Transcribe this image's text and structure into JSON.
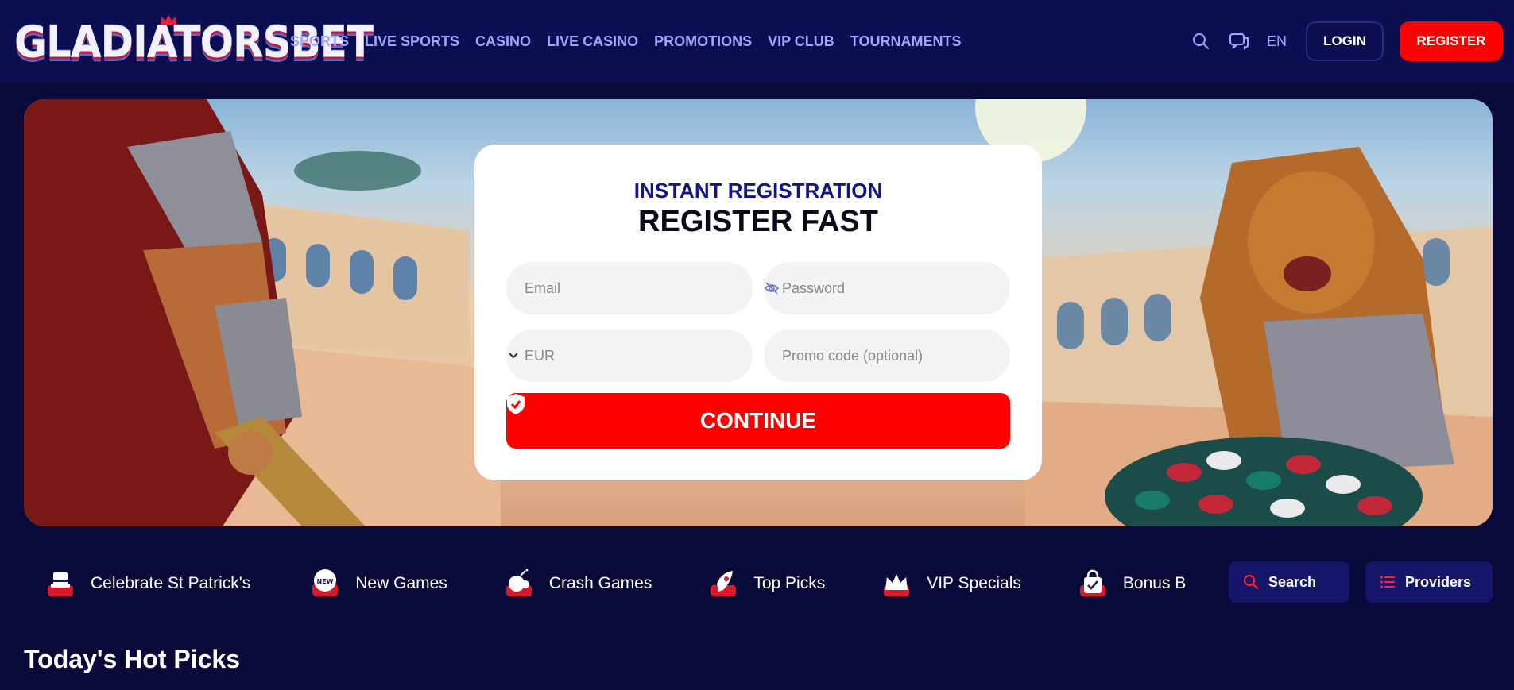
{
  "brand": {
    "logo_text": "GLADIATORSBET"
  },
  "nav": {
    "items": [
      "SPORTS",
      "LIVE SPORTS",
      "CASINO",
      "LIVE CASINO",
      "PROMOTIONS",
      "VIP CLUB",
      "TOURNAMENTS"
    ]
  },
  "header": {
    "language": "EN",
    "login_label": "LOGIN",
    "register_label": "REGISTER"
  },
  "registration": {
    "subtitle": "INSTANT REGISTRATION",
    "title": "REGISTER FAST",
    "email_placeholder": "Email",
    "password_placeholder": "Password",
    "currency_value": "EUR",
    "promo_placeholder": "Promo code (optional)",
    "continue_label": "CONTINUE"
  },
  "categories": {
    "items": [
      {
        "label": "Celebrate St Patrick's",
        "icon": "hat-icon"
      },
      {
        "label": "New Games",
        "icon": "new-badge-icon"
      },
      {
        "label": "Crash Games",
        "icon": "bomb-icon"
      },
      {
        "label": "Top Picks",
        "icon": "rocket-icon"
      },
      {
        "label": "VIP Specials",
        "icon": "crown-icon"
      },
      {
        "label": "Bonus B",
        "icon": "shopping-bag-icon"
      }
    ],
    "search_label": "Search",
    "providers_label": "Providers"
  },
  "sections": {
    "hot_picks_title": "Today's Hot Picks"
  },
  "colors": {
    "background": "#0a0a3a",
    "header": "#0d0e52",
    "accent_red": "#ff0000",
    "nav_text": "#9fa6ff",
    "registration_subtitle": "#14148a"
  }
}
